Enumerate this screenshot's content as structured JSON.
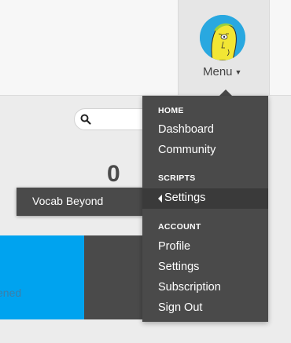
{
  "header": {
    "menu_label": "Menu",
    "avatar_icon": "cartoon-face-avatar"
  },
  "toolbar": {
    "search_placeholder": ""
  },
  "stats": {
    "count": "0"
  },
  "tiles": {
    "blue_label": "ened"
  },
  "popup": {
    "label": "Vocab Beyond"
  },
  "menu": {
    "home_heading": "HOME",
    "dashboard": "Dashboard",
    "community": "Community",
    "scripts_heading": "SCRIPTS",
    "settings_script": "Settings",
    "account_heading": "ACCOUNT",
    "profile": "Profile",
    "settings_account": "Settings",
    "subscription": "Subscription",
    "sign_out": "Sign Out"
  },
  "colors": {
    "accent_blue": "#00a3ef",
    "menu_bg": "#4a4a4a",
    "active_bg": "#3a3a3a"
  }
}
